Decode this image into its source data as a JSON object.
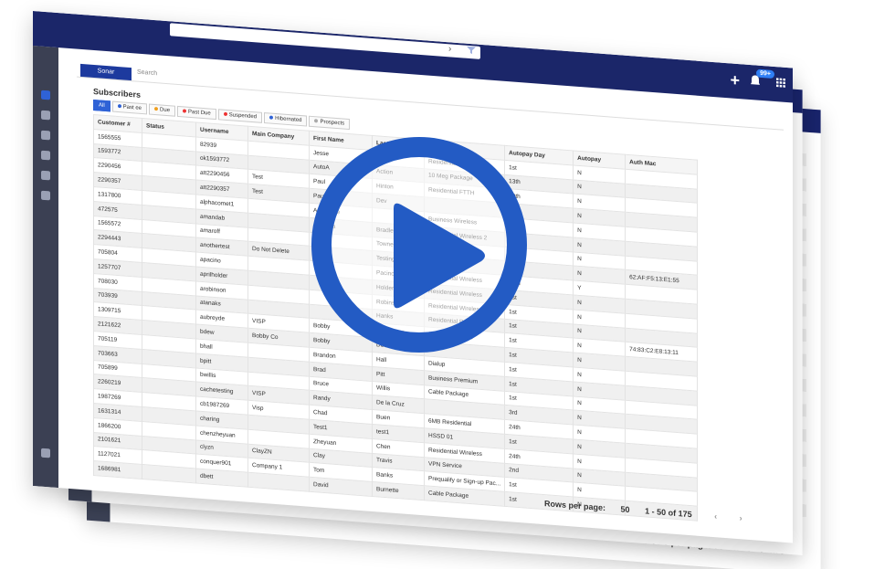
{
  "header": {
    "add_label": "+",
    "badge": "99+",
    "search_placeholder": "Search",
    "logo": "Sonar"
  },
  "page": {
    "title": "Subscribers",
    "tabs": [
      "All",
      "Past ee",
      "Due",
      "Past Due",
      "Suspended",
      "Hibernated",
      "Prospects"
    ]
  },
  "table": {
    "headers": [
      "Customer #",
      "Status",
      "Username",
      "Main Company",
      "First Name",
      "Last Name",
      "Package",
      "Autopay Day",
      "Autopay",
      "Auth Mac"
    ],
    "rows": [
      [
        "1565555",
        "",
        "82939",
        "",
        "Jesse",
        "Hinton",
        "Residential Wireless",
        "1st",
        "N",
        ""
      ],
      [
        "1593772",
        "",
        "ok1593772",
        "",
        "AutoA",
        "Action",
        "10 Meg Package",
        "13th",
        "N",
        ""
      ],
      [
        "2290456",
        "",
        "att2290456",
        "Test",
        "Paul",
        "Hinton",
        "Residential FTTH",
        "10th",
        "N",
        ""
      ],
      [
        "2290357",
        "",
        "att2290357",
        "Test",
        "Paul",
        "Dev",
        "",
        "10th",
        "N",
        ""
      ],
      [
        "1317800",
        "",
        "alphacomet1",
        "",
        "Announce",
        "",
        "Business Wireless",
        "1st",
        "N",
        ""
      ],
      [
        "472575",
        "",
        "amandab",
        "",
        "Amanda",
        "Bradley",
        "Residential Wireless 2",
        "",
        "N",
        ""
      ],
      [
        "1565572",
        "",
        "amaroff",
        "",
        "ot",
        "Towne",
        "ATT 20L",
        "",
        "N",
        ""
      ],
      [
        "2294443",
        "",
        "anothertest",
        "Do Not Delete",
        "",
        "Testing",
        "Cambium Tester",
        "10th",
        "N",
        "62:AF:F5:13:E1:55"
      ],
      [
        "705804",
        "",
        "apacino",
        "",
        "",
        "Pacino",
        "Residential Wireless",
        "15th",
        "Y",
        ""
      ],
      [
        "1257707",
        "",
        "aprilholder",
        "",
        "",
        "Holder",
        "Residential Wireless",
        "1st",
        "N",
        ""
      ],
      [
        "708030",
        "",
        "arobinson",
        "",
        "",
        "Robinson",
        "Residential Wireless",
        "1st",
        "N",
        ""
      ],
      [
        "703939",
        "",
        "atanaks",
        "",
        "",
        "Hanks",
        "Residential Package",
        "1st",
        "N",
        ""
      ],
      [
        "1309715",
        "",
        "aubreyde",
        "VISP",
        "Bobby",
        "De la Cruz",
        "10 Meg Package",
        "1st",
        "N",
        "74:83:C2:E8:13:11"
      ],
      [
        "2121622",
        "",
        "bdew",
        "Bobby Co",
        "Bobby",
        "Dee",
        "",
        "1st",
        "N",
        ""
      ],
      [
        "705119",
        "",
        "bhall",
        "",
        "Brandon",
        "Hall",
        "Dialup",
        "1st",
        "N",
        ""
      ],
      [
        "703663",
        "",
        "bpitt",
        "",
        "Brad",
        "Pitt",
        "Business Premium",
        "1st",
        "N",
        ""
      ],
      [
        "705899",
        "",
        "bwillis",
        "",
        "Bruce",
        "Willis",
        "Cable Package",
        "1st",
        "N",
        ""
      ],
      [
        "2260219",
        "",
        "cachetesting",
        "VISP",
        "Randy",
        "De la Cruz",
        "",
        "3rd",
        "N",
        ""
      ],
      [
        "1987269",
        "",
        "cb1987269",
        "Visp",
        "Chad",
        "Buen",
        "6MB Residential",
        "24th",
        "N",
        ""
      ],
      [
        "1631314",
        "",
        "charing",
        "",
        "Test1",
        "test1",
        "HSSD 01",
        "1st",
        "N",
        ""
      ],
      [
        "1866200",
        "",
        "chenzheyuan",
        "",
        "Zheyuan",
        "Chen",
        "Residential Wireless",
        "24th",
        "N",
        ""
      ],
      [
        "2101621",
        "",
        "clyzn",
        "ClayZN",
        "Clay",
        "Travis",
        "VPN Service",
        "2nd",
        "N",
        ""
      ],
      [
        "1127021",
        "",
        "conquer901",
        "Company 1",
        "Tom",
        "Banks",
        "Prequalify or Sign-up Pac...",
        "1st",
        "N",
        ""
      ],
      [
        "1686981",
        "",
        "dbett",
        "",
        "David",
        "Burnette",
        "Cable Package",
        "1st",
        "N",
        ""
      ]
    ]
  },
  "footer": {
    "rows_per_page_label": "Rows per page:",
    "rows_per_page_value": "50",
    "range": "1 - 50 of 175",
    "prev": "‹",
    "next": "›"
  },
  "colors": {
    "header_bg": "#1b2669",
    "accent": "#235bc4",
    "sidebar_bg": "#3b4053"
  }
}
